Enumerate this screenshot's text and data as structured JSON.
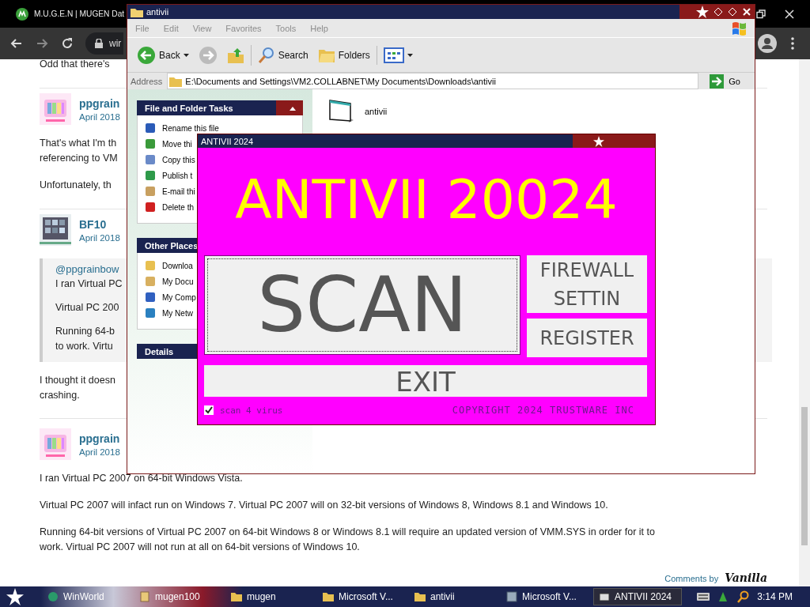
{
  "browser": {
    "tab_title": "M.U.G.E.N | MUGEN Dat",
    "address": "wir",
    "comments_by": "Comments by",
    "logo": "Vanilla"
  },
  "lead": "Odd that there's",
  "posts": [
    {
      "author": "ppgrain",
      "date": "April 2018",
      "paragraphs": [
        [
          "That's what I'm th",
          "referencing to VM"
        ],
        [
          "Unfortunately, th"
        ]
      ]
    },
    {
      "author": "BF10",
      "date": "April 2018",
      "quote": {
        "mention": "@ppgrainbow",
        "paragraphs": [
          [
            "I ran Virtual PC"
          ],
          [
            "Virtual PC 200"
          ],
          [
            "Running 64-b",
            "to work. Virtu"
          ]
        ]
      },
      "paragraphs": [
        [
          "I thought it doesn",
          "crashing."
        ]
      ]
    },
    {
      "author": "ppgrain",
      "date": "April 2018",
      "paragraphs": [
        [
          "I ran Virtual PC 2007 on 64-bit Windows Vista."
        ],
        [
          "Virtual PC 2007 will infact run on Windows 7. Virtual PC 2007 will on 32-bit versions of Windows 8, Windows 8.1 and Windows 10."
        ],
        [
          "Running 64-bit versions of Virtual PC 2007 on 64-bit Windows 8 or Windows 8.1 will require an updated version of VMM.SYS in order for it to",
          "work. Virtual PC 2007 will not run at all on 64-bit versions of Windows 10."
        ]
      ]
    }
  ],
  "explorer": {
    "title": "antivii",
    "menu": [
      {
        "label": "File",
        "disabled": true
      },
      {
        "label": "Edit",
        "disabled": true
      },
      {
        "label": "View",
        "disabled": true
      },
      {
        "label": "Favorites",
        "disabled": true
      },
      {
        "label": "Tools",
        "disabled": true
      },
      {
        "label": "Help",
        "disabled": true
      }
    ],
    "toolbar": [
      {
        "kind": "back",
        "label": "Back"
      },
      {
        "kind": "forward"
      },
      {
        "kind": "up"
      },
      {
        "kind": "search",
        "label": "Search"
      },
      {
        "kind": "folders",
        "label": "Folders"
      },
      {
        "kind": "views"
      }
    ],
    "address_label": "Address",
    "address": "E:\\Documents and Settings\\VM2.COLLABNET\\My Documents\\Downloads\\antivii",
    "go": "Go",
    "panels": [
      {
        "title": "File and Folder Tasks",
        "expanded": true,
        "items": [
          {
            "label": "Rename this file"
          },
          {
            "label": "Move thi"
          },
          {
            "label": "Copy this"
          },
          {
            "label": "Publish t"
          },
          {
            "label": "E-mail thi"
          },
          {
            "label": "Delete th"
          }
        ]
      },
      {
        "title": "Other Places",
        "items": [
          {
            "label": "Downloa"
          },
          {
            "label": "My Docu"
          },
          {
            "label": "My Comp"
          },
          {
            "label": "My Netw"
          }
        ]
      },
      {
        "title": "Details"
      }
    ],
    "files": [
      {
        "name": "antivii"
      }
    ]
  },
  "dialog": {
    "title": "ANTIVII 2024",
    "heading": "ANTIVII 20024",
    "buttons": [
      {
        "label": "SCAN",
        "kind": "main"
      },
      {
        "label": "FIREWALL SETTIN",
        "kind": "side"
      },
      {
        "label": "REGISTER",
        "kind": "side"
      },
      {
        "label": "EXIT",
        "kind": "wide"
      }
    ],
    "checkbox": {
      "label": "scan 4 virus",
      "checked": true
    },
    "copyright": "COPYRIGHT 2024 TRUSTWARE INC"
  },
  "taskbar": {
    "items": [
      {
        "label": "WinWorld",
        "selected": false
      },
      {
        "label": "mugen100",
        "selected": false
      },
      {
        "label": "mugen",
        "selected": false
      },
      {
        "label": "Microsoft V...",
        "selected": false
      },
      {
        "label": "antivii",
        "selected": false
      },
      {
        "label": "Microsoft V...",
        "selected": false
      },
      {
        "label": "ANTIVII 2024",
        "selected": true
      }
    ],
    "clock": "3:14 PM"
  }
}
